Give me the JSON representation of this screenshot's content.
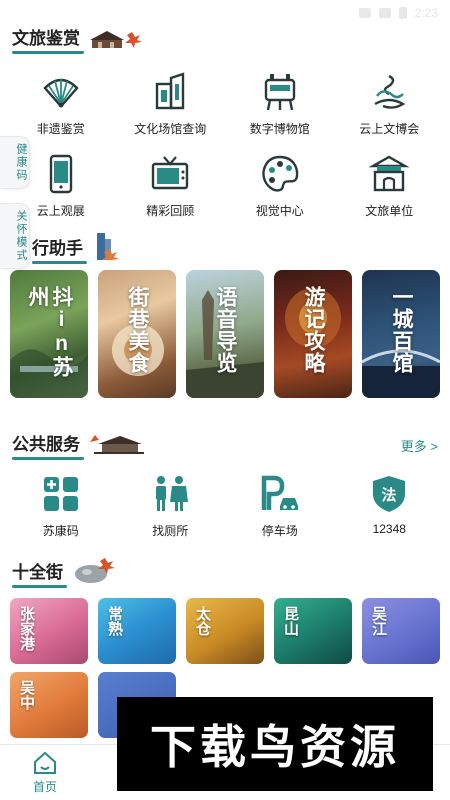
{
  "status": {
    "time": "2:23"
  },
  "sections": {
    "appreciation": {
      "title": "文旅鉴赏"
    },
    "travel": {
      "title": "行助手"
    },
    "public": {
      "title": "公共服务",
      "more": "更多 >"
    },
    "streets": {
      "title": "十全街"
    }
  },
  "side_tabs": [
    {
      "label": "健康码"
    },
    {
      "label": "关怀模式"
    }
  ],
  "appreciation_items": [
    {
      "label": "非遗鉴赏",
      "icon": "fan-icon"
    },
    {
      "label": "文化场馆查询",
      "icon": "building-icon"
    },
    {
      "label": "数字博物馆",
      "icon": "bronze-vessel-icon"
    },
    {
      "label": "云上文博会",
      "icon": "swirl-cloud-icon"
    },
    {
      "label": "云上观展",
      "icon": "phone-icon"
    },
    {
      "label": "精彩回顾",
      "icon": "tv-icon"
    },
    {
      "label": "视觉中心",
      "icon": "palette-icon"
    },
    {
      "label": "文旅单位",
      "icon": "pagoda-gate-icon"
    }
  ],
  "travel_cards": [
    {
      "label": "抖in苏州"
    },
    {
      "label": "街巷美食"
    },
    {
      "label": "语音导览"
    },
    {
      "label": "游记攻略"
    },
    {
      "label": "一城百馆"
    }
  ],
  "public_items": [
    {
      "label": "苏康码",
      "icon": "health-code-icon"
    },
    {
      "label": "找厕所",
      "icon": "restroom-icon"
    },
    {
      "label": "停车场",
      "icon": "parking-icon"
    },
    {
      "label": "12348",
      "icon": "law-shield-icon",
      "glyph": "法"
    }
  ],
  "streets": [
    {
      "label": "张家港"
    },
    {
      "label": "常熟"
    },
    {
      "label": "太仓"
    },
    {
      "label": "昆山"
    },
    {
      "label": "吴江"
    },
    {
      "label": "吴中"
    }
  ],
  "tabbar": [
    {
      "label": "首页"
    }
  ],
  "watermark": {
    "text": "下载鸟资源"
  },
  "colors": {
    "accent": "#2a8a87",
    "text": "#222222"
  }
}
